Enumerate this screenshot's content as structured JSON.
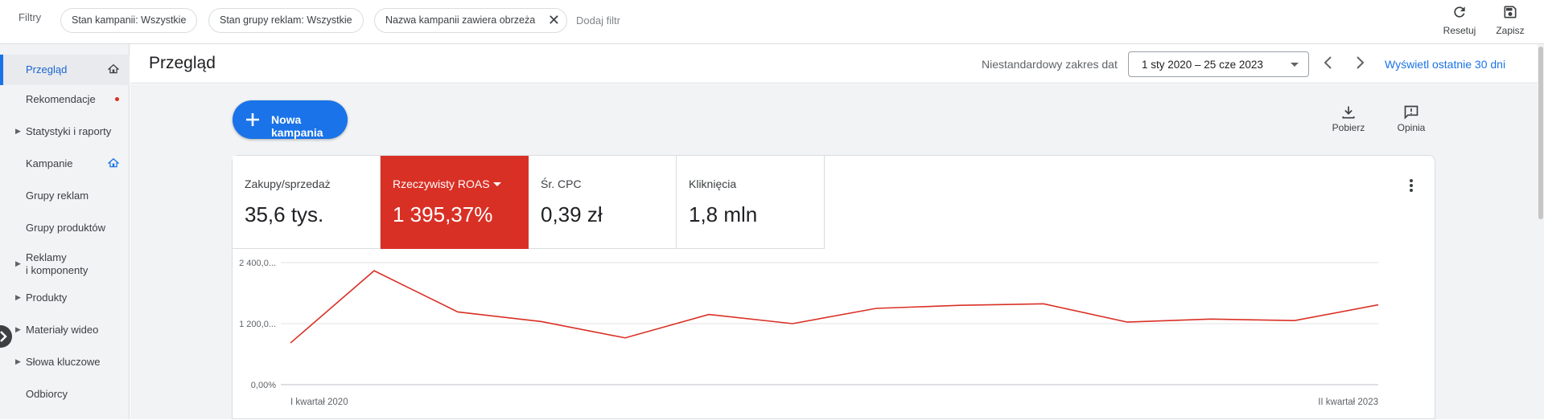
{
  "filterbar": {
    "label": "Filtry",
    "chips": [
      {
        "label": "Stan kampanii: Wszystkie"
      },
      {
        "label": "Stan grupy reklam: Wszystkie"
      },
      {
        "label": "Nazwa kampanii zawiera obrzeża"
      }
    ],
    "add_filter": "Dodaj filtr",
    "reset_label": "Resetuj",
    "save_label": "Zapisz"
  },
  "sidebar": {
    "items": [
      {
        "label": "Przegląd",
        "active": true,
        "home_icon": true
      },
      {
        "label": "Rekomendacje",
        "dot": true
      },
      {
        "label": "Statystyki i raporty",
        "expandable": true
      },
      {
        "label": "Kampanie",
        "home_icon": true
      },
      {
        "label": "Grupy reklam"
      },
      {
        "label": "Grupy produktów"
      },
      {
        "label": "Reklamy i komponenty",
        "line1": "Reklamy",
        "line2": "i komponenty",
        "expandable": true
      },
      {
        "label": "Produkty",
        "expandable": true
      },
      {
        "label": "Materiały wideo",
        "expandable": true
      },
      {
        "label": "Słowa kluczowe",
        "expandable": true
      },
      {
        "label": "Odbiorcy"
      }
    ]
  },
  "header": {
    "title": "Przegląd",
    "date_range_label": "Niestandardowy zakres dat",
    "date_range_value": "1 sty 2020 – 25 cze 2023",
    "last_30_days": "Wyświetl ostatnie 30 dni"
  },
  "main": {
    "new_campaign": "Nowa kampania",
    "download_label": "Pobierz",
    "feedback_label": "Opinia"
  },
  "metrics": [
    {
      "name": "Zakupy/sprzedaż",
      "value": "35,6 tys."
    },
    {
      "name": "Rzeczywisty ROAS",
      "value": "1 395,37%",
      "selected": true
    },
    {
      "name": "Śr. CPC",
      "value": "0,39 zł"
    },
    {
      "name": "Kliknięcia",
      "value": "1,8 mln"
    }
  ],
  "colors": {
    "accent": "#1a73e8",
    "selected_metric": "#d93025",
    "series_line": "#d93025"
  },
  "chart_data": {
    "type": "line",
    "x_start_label": "I kwartał 2020",
    "x_end_label": "II kwartał 2023",
    "ytick_labels": [
      "2 400,0...",
      "1 200,0...",
      "0,00%"
    ],
    "ylim": [
      0,
      2400
    ],
    "grid": true,
    "series": [
      {
        "values": [
          820,
          2240,
          1430,
          1240,
          920,
          1380,
          1200,
          1500,
          1560,
          1590,
          1230,
          1290,
          1260,
          1570
        ]
      }
    ]
  }
}
